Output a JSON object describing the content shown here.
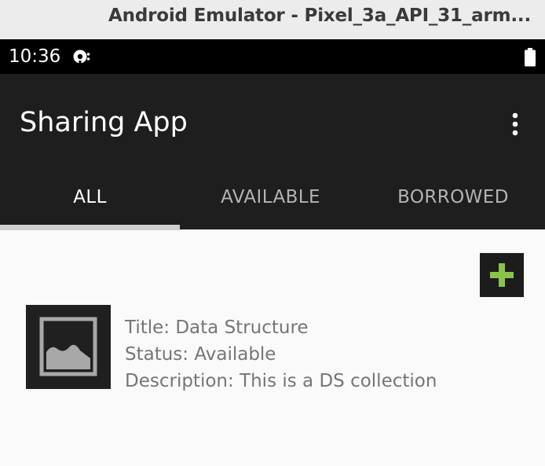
{
  "window": {
    "title": "Android Emulator - Pixel_3a_API_31_arm..."
  },
  "status_bar": {
    "time": "10:36",
    "notification_icon": "sync-notification-icon",
    "battery_icon": "battery-full-icon"
  },
  "toolbar": {
    "title": "Sharing App",
    "overflow_icon": "more-vert-icon"
  },
  "tabs": [
    {
      "label": "ALL",
      "selected": true
    },
    {
      "label": "AVAILABLE",
      "selected": false
    },
    {
      "label": "BORROWED",
      "selected": false
    }
  ],
  "add_button": {
    "icon": "plus-icon",
    "color": "#8bc34a"
  },
  "items": [
    {
      "thumbnail_icon": "image-placeholder-icon",
      "title": "Title: Data Structure",
      "status": "Status: Available",
      "description": "Description: This is a DS collection"
    }
  ],
  "colors": {
    "toolbar": "#1e1e1e",
    "status_bar": "#000000",
    "background": "#fafafa",
    "tab_selected_text": "#ffffff",
    "tab_unselected_text": "#b3b3b3",
    "tab_indicator": "#cfcfcf",
    "item_text": "#757575"
  }
}
